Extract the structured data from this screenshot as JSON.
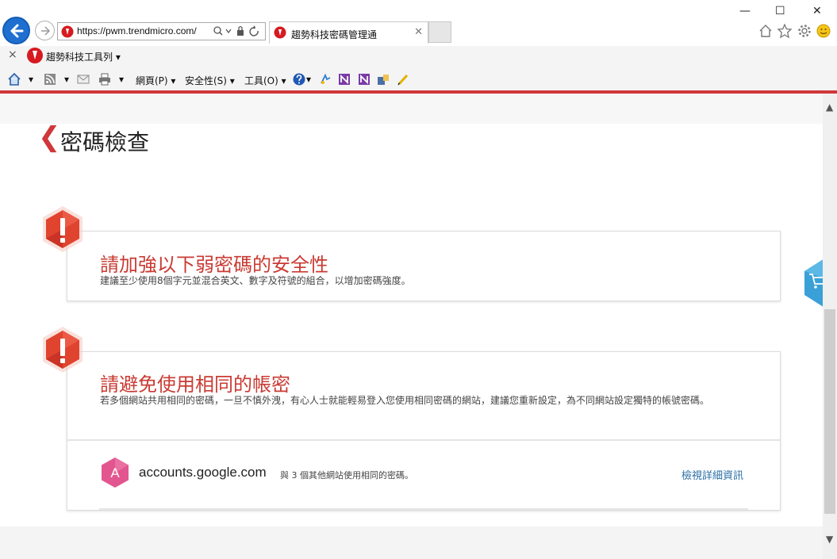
{
  "browser": {
    "url": "https://pwm.trendmicro.com/",
    "tab_title": "趨勢科技密碼管理通",
    "window_controls": {
      "minimize": "—",
      "maximize": "☐",
      "close": "✕"
    },
    "right_icons": [
      "home-icon",
      "star-icon",
      "gear-icon",
      "smiley-icon"
    ]
  },
  "toolbar2": {
    "close": "×",
    "label": "趨勢科技工具列 ▾"
  },
  "toolbar3": {
    "page_menu": "網頁(P) ▾",
    "safety_menu": "安全性(S) ▾",
    "tools_menu": "工具(O) ▾"
  },
  "page": {
    "title": "密碼檢查",
    "back_glyph": "❮"
  },
  "cards": {
    "weak": {
      "title": "請加強以下弱密碼的安全性",
      "desc": "建議至少使用8個字元並混合英文、數字及符號的組合，以增加密碼強度。"
    },
    "reuse": {
      "title": "請避免使用相同的帳密",
      "desc": "若多個網站共用相同的密碼，一旦不慎外洩，有心人士就能輕易登入您使用相同密碼的網站，建議您重新設定，為不同網站設定獨特的帳號密碼。",
      "site": {
        "avatar_letter": "A",
        "domain": "accounts.google.com",
        "note": "與 3 個其他網站使用相同的密碼。",
        "link": "檢視詳細資訊"
      }
    }
  },
  "colors": {
    "accent_red": "#d0373a",
    "title_red": "#c93b33",
    "link_blue": "#2a6ea6",
    "avatar_pink": "#e2558f",
    "shop_blue": "#3aa0d8"
  }
}
